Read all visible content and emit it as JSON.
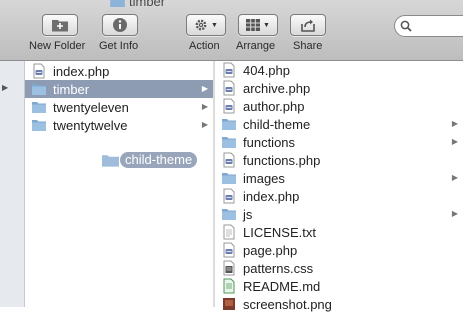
{
  "window": {
    "title": "timber"
  },
  "toolbar": {
    "new_folder": "New Folder",
    "get_info": "Get Info",
    "action": "Action",
    "arrange": "Arrange",
    "share": "Share"
  },
  "column1": {
    "items": [
      {
        "label": "index.php",
        "type": "php"
      },
      {
        "label": "timber",
        "type": "folder",
        "selected": true
      },
      {
        "label": "twentyeleven",
        "type": "folder"
      },
      {
        "label": "twentytwelve",
        "type": "folder"
      }
    ],
    "drag_label": "child-theme"
  },
  "column2": {
    "items": [
      {
        "label": "404.php",
        "type": "php"
      },
      {
        "label": "archive.php",
        "type": "php"
      },
      {
        "label": "author.php",
        "type": "php"
      },
      {
        "label": "child-theme",
        "type": "folder"
      },
      {
        "label": "functions",
        "type": "folder"
      },
      {
        "label": "functions.php",
        "type": "php"
      },
      {
        "label": "images",
        "type": "folder"
      },
      {
        "label": "index.php",
        "type": "php"
      },
      {
        "label": "js",
        "type": "folder"
      },
      {
        "label": "LICENSE.txt",
        "type": "txt"
      },
      {
        "label": "page.php",
        "type": "php"
      },
      {
        "label": "patterns.css",
        "type": "css"
      },
      {
        "label": "README.md",
        "type": "md"
      },
      {
        "label": "screenshot.png",
        "type": "png"
      }
    ]
  },
  "colors": {
    "selection": "#8e9cb3",
    "folder": "#7fa8cf"
  }
}
